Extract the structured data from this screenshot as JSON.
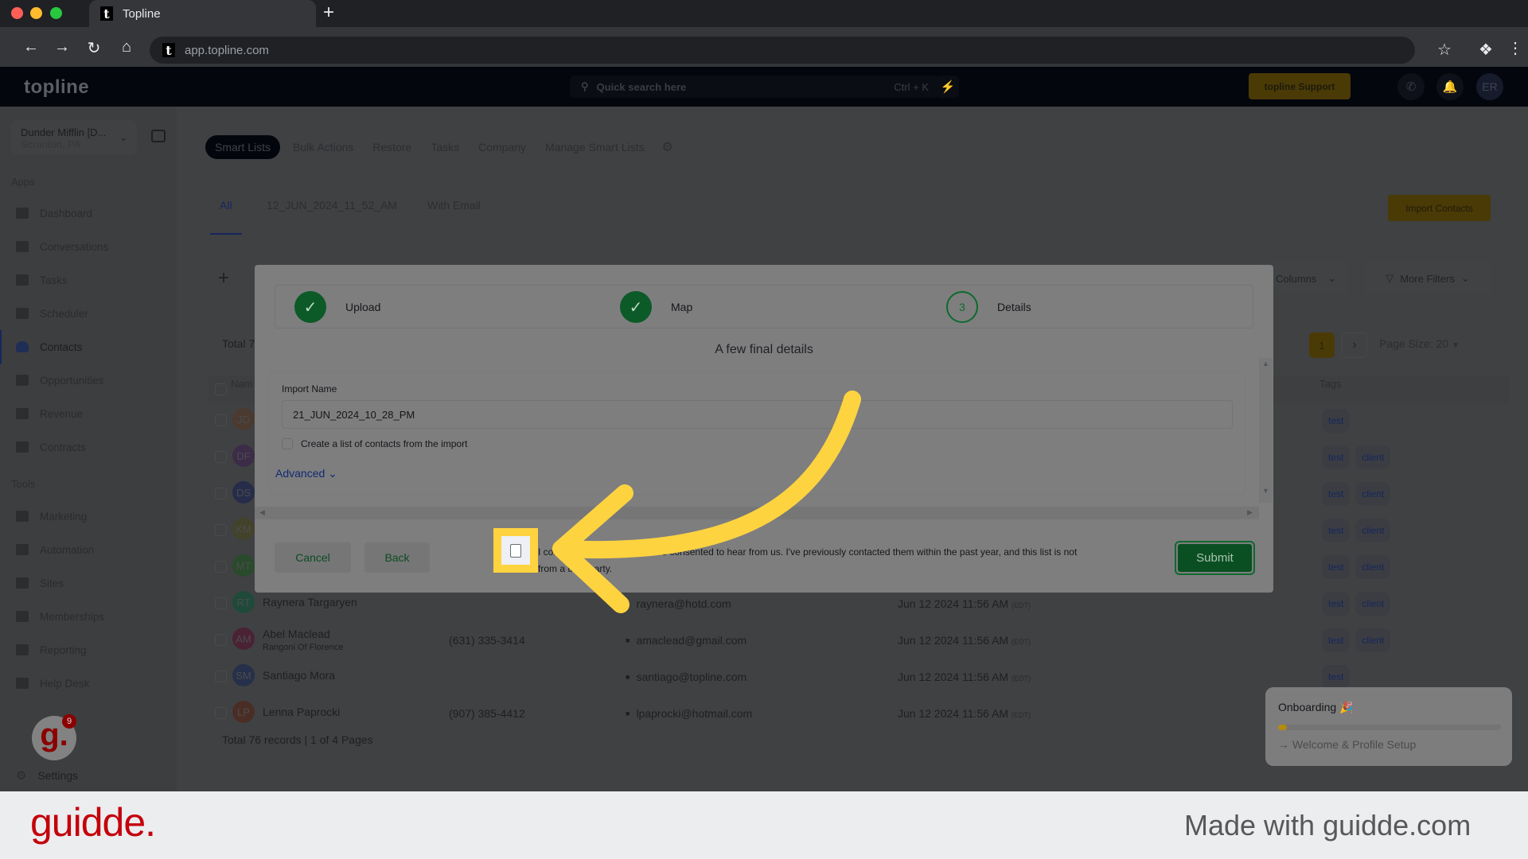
{
  "browser": {
    "tab_title": "Topline",
    "new_tab_icon": "plus-icon",
    "url": "app.topline.com"
  },
  "header": {
    "logo": "topline",
    "search_placeholder": "Quick search here",
    "search_shortcut": "Ctrl + K",
    "support_label": "topline Support",
    "avatar_initials": "ER"
  },
  "sidebar": {
    "account_name": "Dunder Mifflin [D...",
    "account_location": "Scranton, PA",
    "apps_heading": "Apps",
    "apps": [
      {
        "label": "Dashboard",
        "icon": "dashboard-icon"
      },
      {
        "label": "Conversations",
        "icon": "chat-icon"
      },
      {
        "label": "Tasks",
        "icon": "task-icon"
      },
      {
        "label": "Scheduler",
        "icon": "calendar-icon"
      },
      {
        "label": "Contacts",
        "icon": "person-icon",
        "active": true
      },
      {
        "label": "Opportunities",
        "icon": "target-icon"
      },
      {
        "label": "Revenue",
        "icon": "credit-card-icon"
      },
      {
        "label": "Contracts",
        "icon": "document-icon"
      }
    ],
    "tools_heading": "Tools",
    "tools": [
      {
        "label": "Marketing",
        "icon": "megaphone-icon"
      },
      {
        "label": "Automation",
        "icon": "gears-icon"
      },
      {
        "label": "Sites",
        "icon": "globe-icon"
      },
      {
        "label": "Memberships",
        "icon": "users-icon"
      },
      {
        "label": "Reporting",
        "icon": "pie-chart-icon"
      },
      {
        "label": "Help Desk",
        "icon": "help-icon"
      }
    ],
    "settings_label": "Settings"
  },
  "top_tabs": [
    "Smart Lists",
    "Bulk Actions",
    "Restore",
    "Tasks",
    "Company",
    "Manage Smart Lists"
  ],
  "smart_list_tabs": [
    "All",
    "12_JUN_2024_11_52_AM",
    "With Email"
  ],
  "import_contacts_label": "Import Contacts",
  "filters": {
    "columns_label": "Columns",
    "more_filters_label": "More Filters"
  },
  "table": {
    "total_label": "Total 7",
    "current_page": "1",
    "page_size_label": "Page Size: 20",
    "name_header": "Nam",
    "tags_header": "Tags",
    "rows": [
      {
        "initials": "JD",
        "color": "#4a3a30",
        "tags": [
          "test"
        ]
      },
      {
        "initials": "DF",
        "color": "#3c2c48",
        "tags": [
          "test",
          "client"
        ]
      },
      {
        "initials": "DS",
        "color": "#262c4a",
        "tags": [
          "test",
          "client"
        ]
      },
      {
        "initials": "KM",
        "color": "#43422a",
        "tags": [
          "test",
          "client"
        ]
      },
      {
        "initials": "MT",
        "color": "#2a4a2c",
        "tags": [
          "test",
          "client"
        ]
      },
      {
        "initials": "RT",
        "color": "#1f4a3a",
        "name": "Raynera Targaryen",
        "company": "",
        "phone": "",
        "email": "raynera@hotd.com",
        "date": "Jun 12 2024 11:56 AM",
        "tz": "(EDT)",
        "tags": [
          "test",
          "client"
        ]
      },
      {
        "initials": "AM",
        "color": "#4a2233",
        "name": "Abel Maclead",
        "company": "Rangoni Of Florence",
        "phone": "(631) 335-3414",
        "email": "amaclead@gmail.com",
        "date": "Jun 12 2024 11:56 AM",
        "tz": "(EDT)",
        "tags": [
          "test",
          "client"
        ]
      },
      {
        "initials": "SM",
        "color": "#26304a",
        "name": "Santiago Mora",
        "company": "",
        "phone": "",
        "email": "santiago@topline.com",
        "date": "Jun 12 2024 11:56 AM",
        "tz": "(EDT)",
        "tags": [
          "test"
        ]
      },
      {
        "initials": "LP",
        "color": "#4a2e26",
        "name": "Lenna Paprocki",
        "company": "",
        "phone": "(907) 385-4412",
        "email": "lpaprocki@hotmail.com",
        "date": "Jun 12 2024 11:56 AM",
        "tz": "(EDT)",
        "tags": []
      }
    ],
    "footer": "Total 76 records | 1 of 4 Pages"
  },
  "onboarding": {
    "title": "Onboarding 🎉",
    "progress_percent": 4,
    "step": "Welcome & Profile Setup"
  },
  "guidde_badge_count": "9",
  "modal": {
    "steps": [
      {
        "label": "Upload",
        "status": "done"
      },
      {
        "label": "Map",
        "status": "done"
      },
      {
        "label": "Details",
        "status": "current",
        "number": "3"
      }
    ],
    "subtitle": "A few final details",
    "import_name_label": "Import Name",
    "import_name_value": "21_JUN_2024_10_28_PM",
    "create_list_label": "Create a list of contacts from the import",
    "create_list_checked": false,
    "advanced_label": "Advanced",
    "consent_text": "I confirm that all contacts have consented to hear from us. I've previously contacted them within the past year, and this list is not from a third party.",
    "consent_checked": false,
    "cancel_label": "Cancel",
    "back_label": "Back",
    "submit_label": "Submit"
  },
  "guidde": {
    "logo": "guidde.",
    "made_with": "Made with guidde.com"
  }
}
